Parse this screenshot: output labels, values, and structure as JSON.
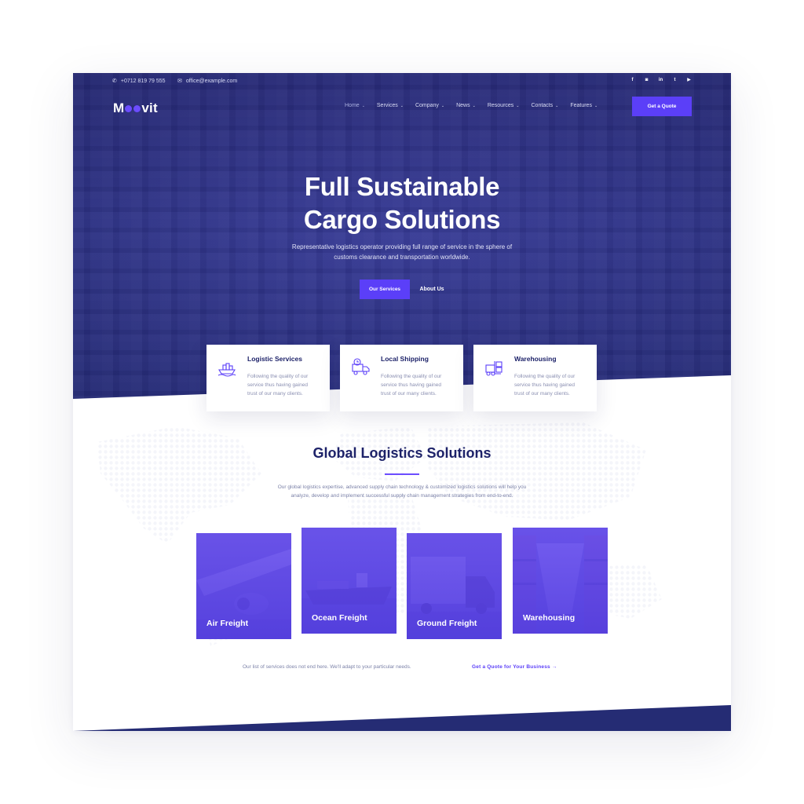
{
  "topbar": {
    "phone": "+0712 819 79 555",
    "email": "office@example.com",
    "socials": [
      "facebook-icon",
      "instagram-icon",
      "linkedin-icon",
      "twitter-icon",
      "youtube-icon"
    ]
  },
  "brand": {
    "logo_pre": "M",
    "logo_post": "vit"
  },
  "nav": {
    "items": [
      "Home",
      "Services",
      "Company",
      "News",
      "Resources",
      "Contacts",
      "Features"
    ],
    "cta": "Get a Quote"
  },
  "hero": {
    "title_line1": "Full Sustainable",
    "title_line2": "Cargo Solutions",
    "subtitle_line1": "Representative logistics operator providing full range of service in the sphere of",
    "subtitle_line2": "customs clearance and transportation worldwide.",
    "primary_btn": "Our Services",
    "secondary_btn": "About Us"
  },
  "features": [
    {
      "title": "Logistic Services",
      "text": "Following the quality of our service thus having gained trust of our many clients.",
      "icon": "cargo-ship-icon"
    },
    {
      "title": "Local Shipping",
      "text": "Following the quality of our service thus having gained trust of our many clients.",
      "icon": "delivery-truck-icon"
    },
    {
      "title": "Warehousing",
      "text": "Following the quality of our service thus having gained trust of our many clients.",
      "icon": "forklift-icon"
    }
  ],
  "section": {
    "title": "Global Logistics Solutions",
    "subtitle_line1": "Our global logistics expertise, advanced supply chain technology & customized logistics solutions will help you",
    "subtitle_line2": "analyze, develop and implement successful supply chain management strategies from end-to-end."
  },
  "services": [
    "Air Freight",
    "Ocean Freight",
    "Ground Freight",
    "Warehousing"
  ],
  "footer": {
    "note": "Our list of services does not end here. We'll adapt to your particular needs.",
    "link": "Get a Quote for Your Business →"
  },
  "colors": {
    "accent": "#5b3ff8",
    "navy": "#1d2269",
    "hero_overlay": "#2f3588"
  }
}
